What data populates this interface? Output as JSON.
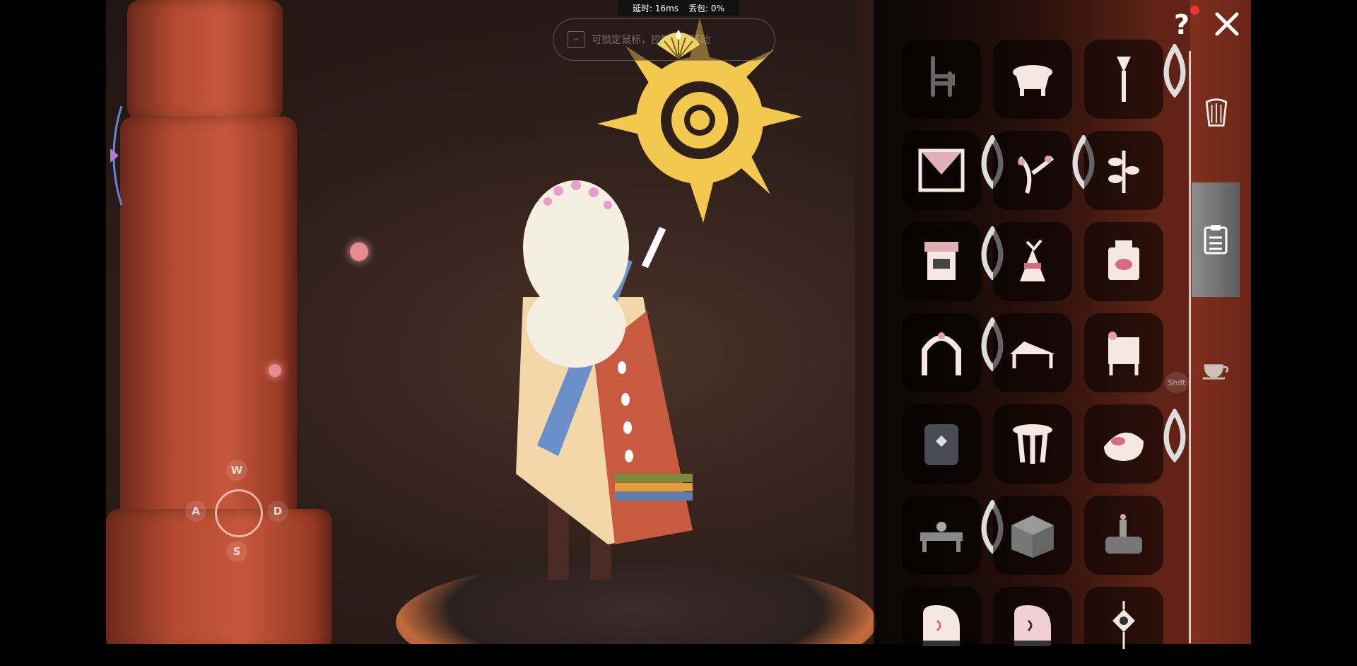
{
  "hud": {
    "latency_label": "延时: 16ms",
    "packet_loss_label": "丢包: 0%",
    "hint_key": "∸",
    "hint_text": "可锁定鼠标，控制视角移动"
  },
  "wasd": {
    "w": "W",
    "a": "A",
    "s": "S",
    "d": "D"
  },
  "panel": {
    "shift_label": "Shift",
    "items": [
      {
        "name": "chair",
        "drop": false
      },
      {
        "name": "pot",
        "drop": false
      },
      {
        "name": "torch-staff",
        "drop": true
      },
      {
        "name": "curtain-frame",
        "drop": true
      },
      {
        "name": "branch",
        "drop": true
      },
      {
        "name": "plant",
        "drop": false
      },
      {
        "name": "stall",
        "drop": true
      },
      {
        "name": "bird-statue",
        "drop": false
      },
      {
        "name": "lantern-box",
        "drop": false
      },
      {
        "name": "arch-flowers",
        "drop": true
      },
      {
        "name": "lounge-chair",
        "drop": false
      },
      {
        "name": "flower-chair",
        "drop": false
      },
      {
        "name": "stone-shrine",
        "drop": false
      },
      {
        "name": "stool",
        "drop": false
      },
      {
        "name": "cushion",
        "drop": true
      },
      {
        "name": "tea-table",
        "drop": true
      },
      {
        "name": "chest-box",
        "drop": false
      },
      {
        "name": "candle-set",
        "drop": false
      },
      {
        "name": "piano-white",
        "drop": false
      },
      {
        "name": "piano-pink",
        "drop": false
      },
      {
        "name": "hanging-ornament",
        "drop": false
      }
    ]
  },
  "tabs": [
    "harp-icon",
    "list-icon",
    "teacup-icon"
  ],
  "colors": {
    "sun": "#f2c94c",
    "accent_red": "#e33333",
    "orb": "#e98a8f"
  }
}
